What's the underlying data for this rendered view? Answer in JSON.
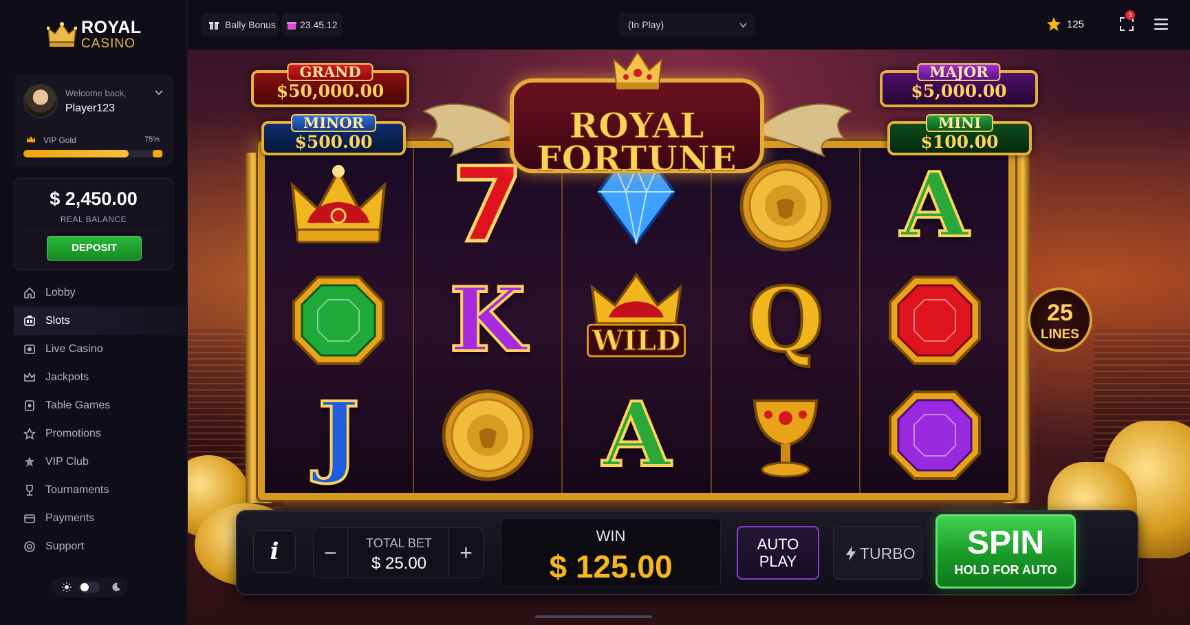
{
  "brand": {
    "line1": "ROYAL",
    "line2": "CASINO"
  },
  "user": {
    "welcome": "Welcome back,",
    "name": "Player123",
    "vip_label": "VIP Gold",
    "vip_progress_text": "75%",
    "vip_progress": 0.75
  },
  "balance": {
    "amount": "$ 2,450.00",
    "label": "REAL BALANCE",
    "deposit_label": "DEPOSIT"
  },
  "nav": [
    {
      "label": "Lobby",
      "icon": "home-icon"
    },
    {
      "label": "Slots",
      "icon": "slots-icon",
      "active": true
    },
    {
      "label": "Live Casino",
      "icon": "live-icon"
    },
    {
      "label": "Jackpots",
      "icon": "crown-icon"
    },
    {
      "label": "Table Games",
      "icon": "cards-icon"
    },
    {
      "label": "Promotions",
      "icon": "star-icon"
    },
    {
      "label": "VIP Club",
      "icon": "vip-icon"
    },
    {
      "label": "Tournaments",
      "icon": "trophy-icon"
    },
    {
      "label": "Payments",
      "icon": "wallet-icon"
    },
    {
      "label": "Support",
      "icon": "support-icon"
    }
  ],
  "topbar": {
    "bonus_label": "Bally Bonus",
    "timer": "23.45.12",
    "mode_select": "(In Play)",
    "stars_count": "125",
    "notification_count": "3"
  },
  "game": {
    "title_line1": "ROYAL",
    "title_line2": "FORTUNE",
    "jackpots": {
      "grand": {
        "label": "GRAND",
        "value": "$50,000.00"
      },
      "minor": {
        "label": "MINOR",
        "value": "$500.00"
      },
      "major": {
        "label": "MAJOR",
        "value": "$5,000.00"
      },
      "mini": {
        "label": "MINI",
        "value": "$100.00"
      }
    },
    "lines": {
      "count": "25",
      "label": "LINES"
    },
    "reels": [
      [
        "crown",
        "green-gem",
        "J"
      ],
      [
        "7",
        "K",
        "lion-coin"
      ],
      [
        "diamond",
        "wild",
        "A"
      ],
      [
        "lion-coin",
        "Q",
        "chalice"
      ],
      [
        "A",
        "red-gem",
        "purple-gem"
      ]
    ],
    "wild_text": "WILD",
    "seven_text": "7"
  },
  "controls": {
    "info_label": "i",
    "minus_label": "−",
    "plus_label": "+",
    "total_bet_label": "TOTAL BET",
    "total_bet_value": "$ 25.00",
    "win_label": "WIN",
    "win_value": "$ 125.00",
    "auto_line1": "AUTO",
    "auto_line2": "PLAY",
    "turbo_label": "TURBO",
    "spin_label": "SPIN",
    "spin_sub": "HOLD FOR AUTO"
  },
  "colors": {
    "accent_gold": "#e9b949",
    "win": "#f7b716",
    "spin_green": "#1a9a28",
    "auto_purple": "#8c3ad6"
  }
}
